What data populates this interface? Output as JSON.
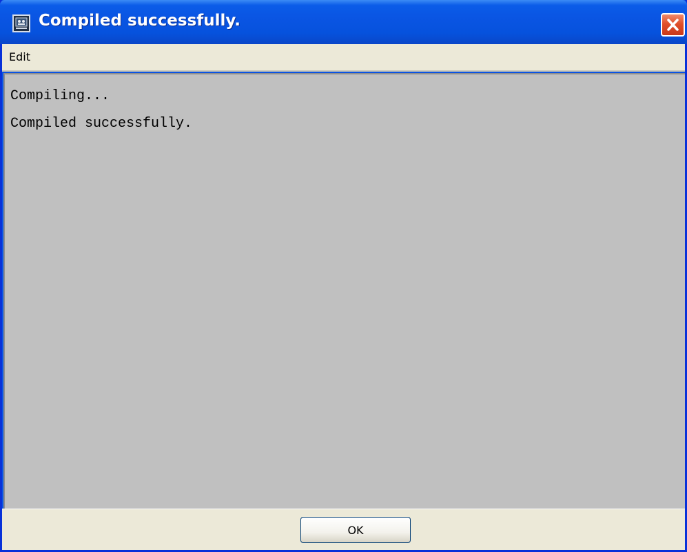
{
  "window": {
    "title": "Compiled successfully.",
    "icon": "terminal-icon",
    "close_icon": "close-icon"
  },
  "menubar": {
    "items": [
      {
        "label": "Edit"
      }
    ]
  },
  "output": {
    "lines": [
      "Compiling...",
      "Compiled successfully."
    ]
  },
  "footer": {
    "ok_label": "OK"
  },
  "colors": {
    "titlebar": "#0a55e3",
    "close_button": "#e0502a",
    "content_background": "#c0c0c0",
    "chrome": "#ece9d8"
  }
}
